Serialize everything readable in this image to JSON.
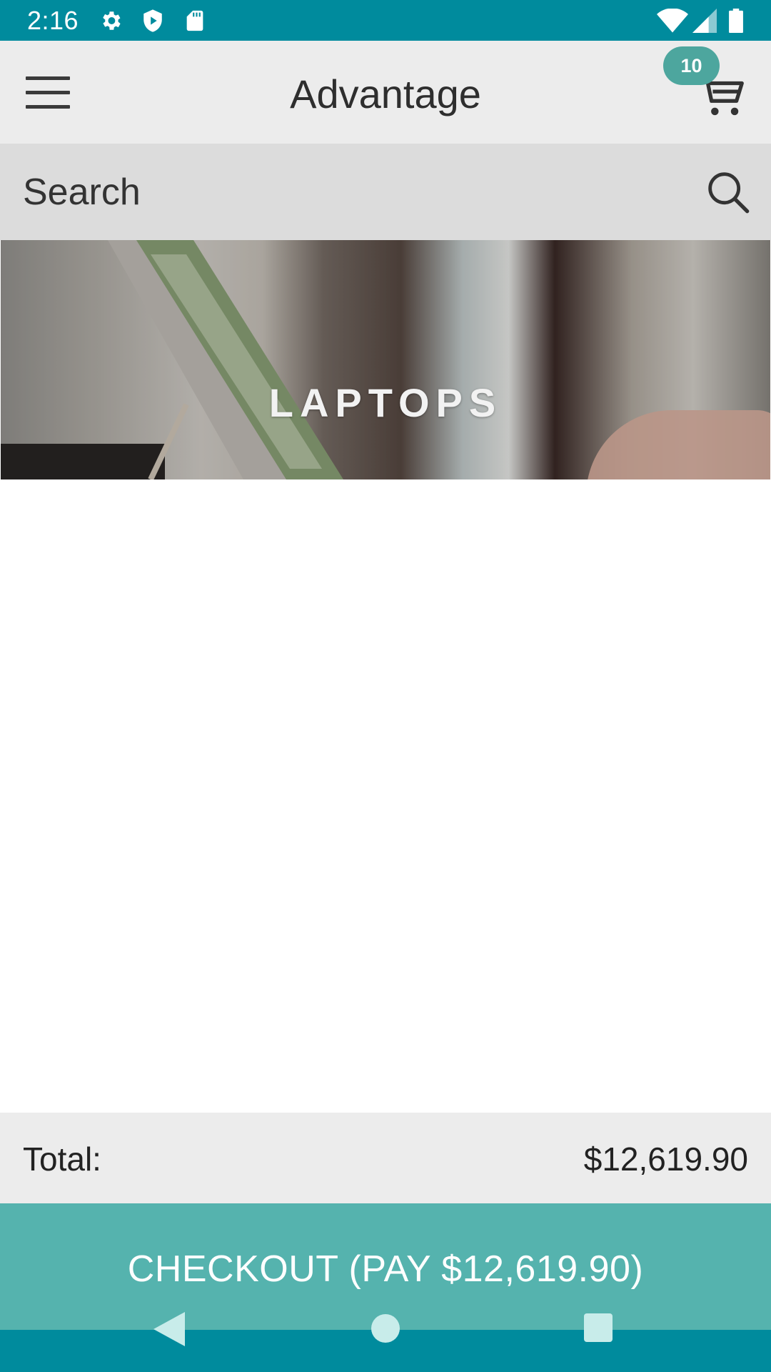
{
  "status_bar": {
    "time": "2:16",
    "background": "#008b9d",
    "icons_left": [
      "gear-icon",
      "play-shield-icon",
      "sd-card-icon"
    ],
    "icons_right": [
      "wifi-icon",
      "signal-icon",
      "battery-icon"
    ]
  },
  "app_bar": {
    "title": "Advantage",
    "menu_icon": "hamburger-icon",
    "cart_icon": "cart-icon",
    "cart_count": "10",
    "badge_color": "#4da69e"
  },
  "search": {
    "placeholder": "Search",
    "icon": "search-icon"
  },
  "banner": {
    "label": "LAPTOPS"
  },
  "cart_summary": {
    "total_label": "Total:",
    "total_value": "$12,619.90"
  },
  "checkout": {
    "label": "CHECKOUT (PAY $12,619.90)",
    "color": "#55b3ae"
  },
  "nav_bar": {
    "buttons": [
      "back-icon",
      "home-icon",
      "recents-icon"
    ]
  }
}
